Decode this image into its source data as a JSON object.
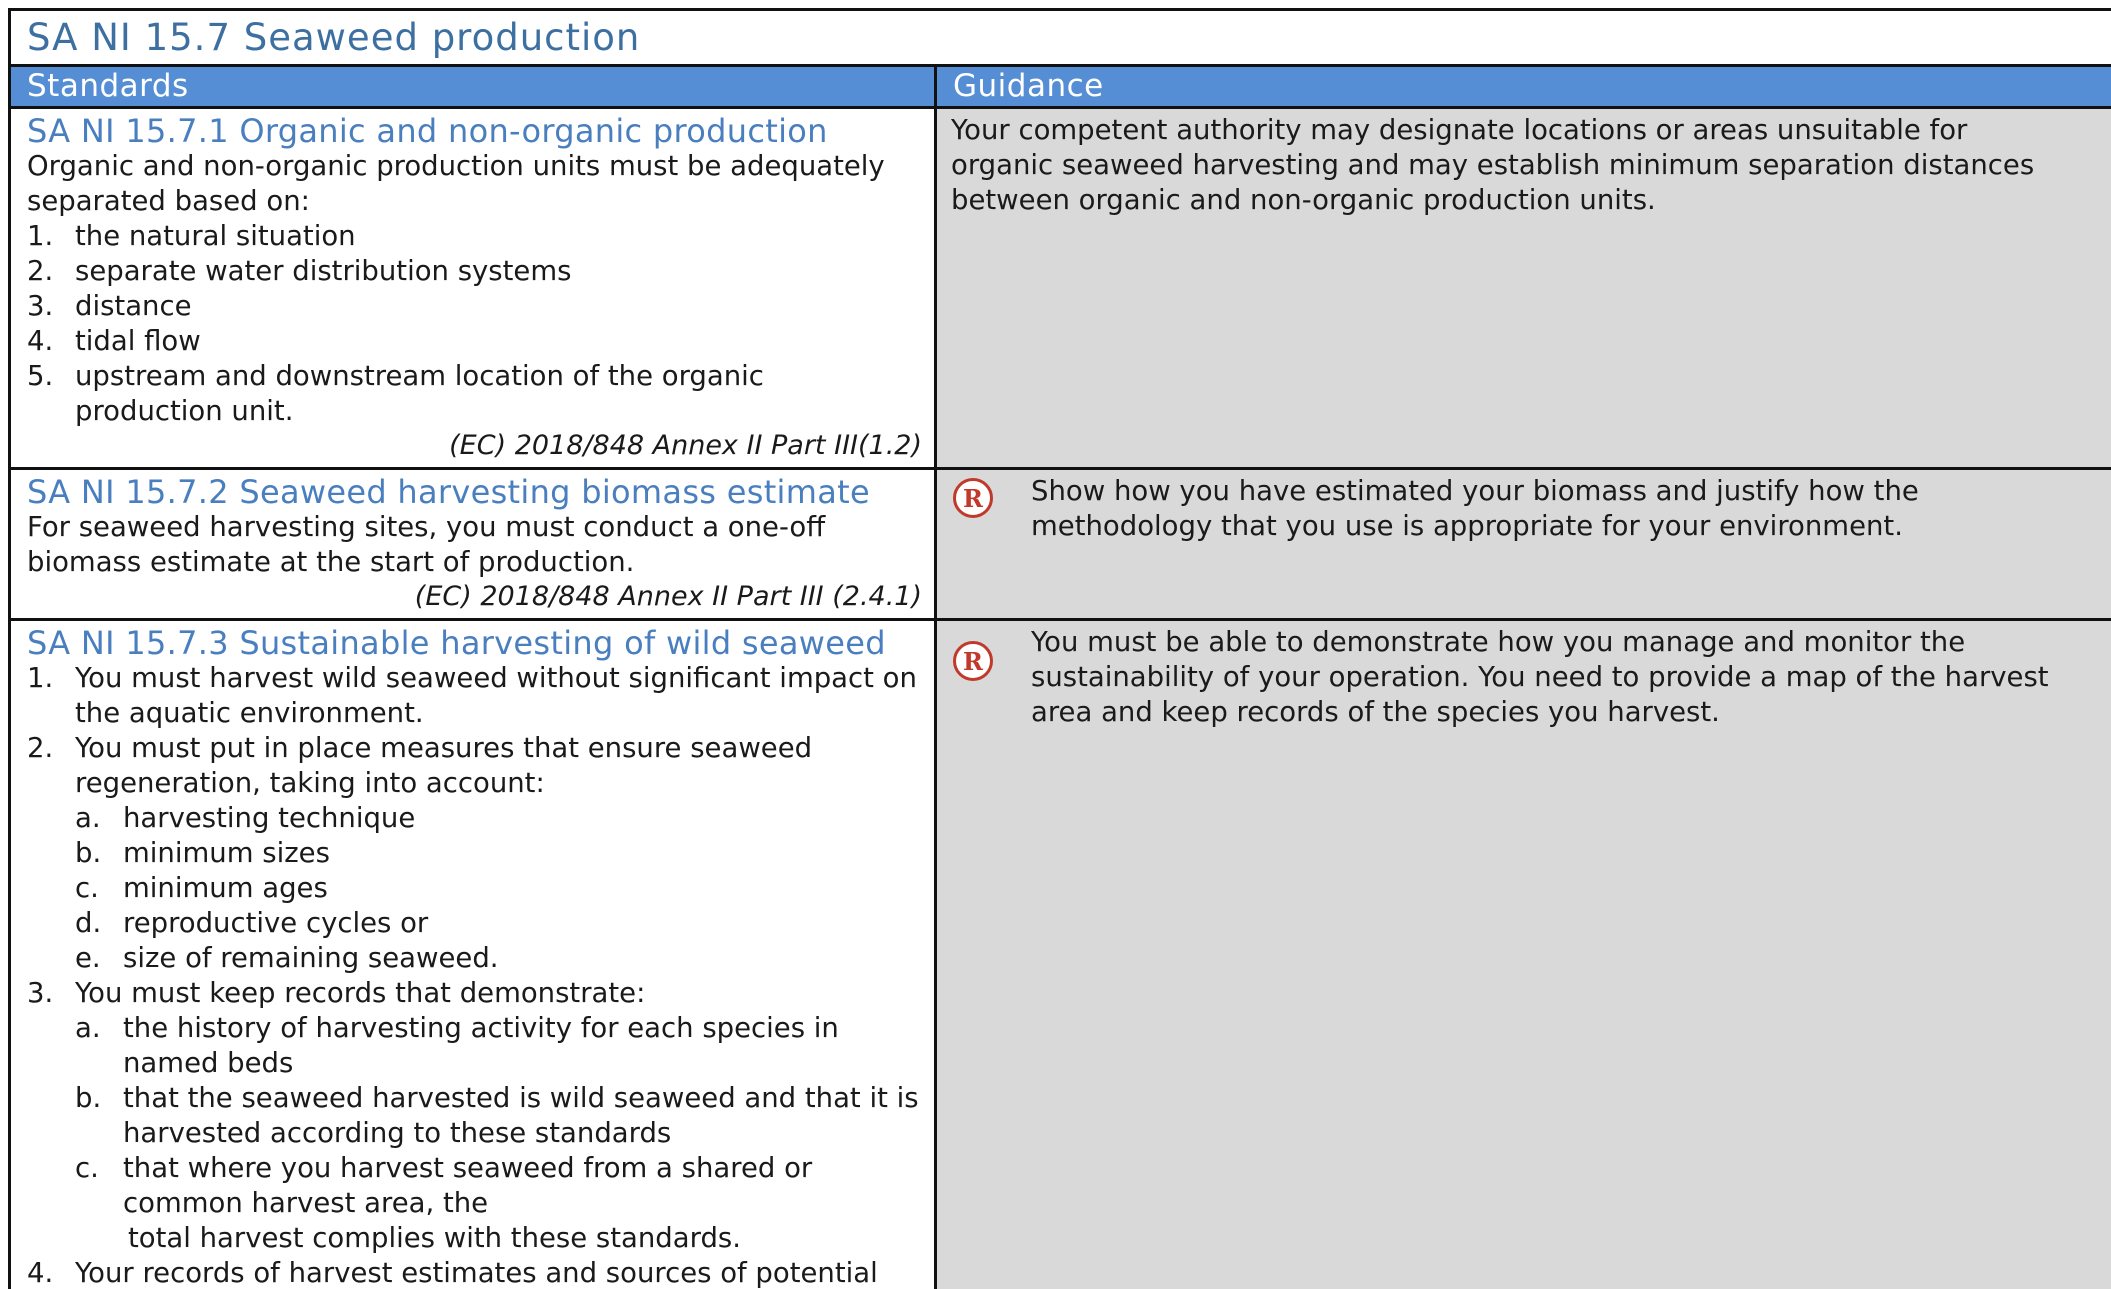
{
  "section_title": "SA NI 15.7 Seaweed production",
  "headers": {
    "standards": "Standards",
    "guidance": "Guidance"
  },
  "rows": [
    {
      "title": "SA NI 15.7.1 Organic and non-organic production",
      "intro": "Organic and non-organic production units must be adequately separated based on:",
      "items": [
        {
          "marker": "1.",
          "text": "the natural situation"
        },
        {
          "marker": "2.",
          "text": "separate water distribution systems"
        },
        {
          "marker": "3.",
          "text": "distance"
        },
        {
          "marker": "4.",
          "text": "tidal flow"
        },
        {
          "marker": "5.",
          "text": "upstream and downstream location of the organic production unit."
        }
      ],
      "reference": "(EC) 2018/848 Annex II Part III(1.2)",
      "guidance": "Your competent authority may designate locations or areas unsuitable for organic seaweed harvesting and may establish minimum separation distances between organic and non-organic production units."
    },
    {
      "title": "SA NI 15.7.2 Seaweed harvesting biomass estimate",
      "intro": "For seaweed harvesting sites, you must conduct a one-off biomass estimate at the start of production.",
      "reference": "(EC) 2018/848 Annex II Part III (2.4.1)",
      "badge": "R",
      "guidance": "Show how you have estimated your biomass and justify how the methodology that you use is appropriate for your environment."
    },
    {
      "title": "SA NI 15.7.3 Sustainable harvesting of wild seaweed",
      "item1": {
        "marker": "1.",
        "text": "You must harvest wild seaweed without significant impact on the aquatic environment."
      },
      "item2": {
        "marker": "2.",
        "text": "You must put in place measures that ensure seaweed regeneration, taking into account:"
      },
      "item2_sub": [
        {
          "marker": "a.",
          "text": "harvesting technique"
        },
        {
          "marker": "b.",
          "text": "minimum sizes"
        },
        {
          "marker": "c.",
          "text": "minimum ages"
        },
        {
          "marker": "d.",
          "text": "reproductive cycles or"
        },
        {
          "marker": "e.",
          "text": "size of remaining seaweed."
        }
      ],
      "item3": {
        "marker": "3.",
        "text": "You must keep records that demonstrate:"
      },
      "item3_sub": [
        {
          "marker": "a.",
          "text": "the history of harvesting activity for each species in named beds"
        },
        {
          "marker": "b.",
          "text": "that the seaweed harvested is wild seaweed and that it is harvested according to these standards"
        },
        {
          "marker": "c.",
          "text": "that where you harvest seaweed from a shared or common harvest area, the"
        }
      ],
      "item3_cont": "total harvest complies with these standards.",
      "item4": {
        "marker": "4.",
        "text": "Your records of harvest estimates and sources of potential"
      },
      "badge": "R",
      "guidance": "You must be able to demonstrate how you manage and monitor the sustainability of your operation. You need to provide a map of the harvest area and keep records of the species you harvest."
    }
  ]
}
